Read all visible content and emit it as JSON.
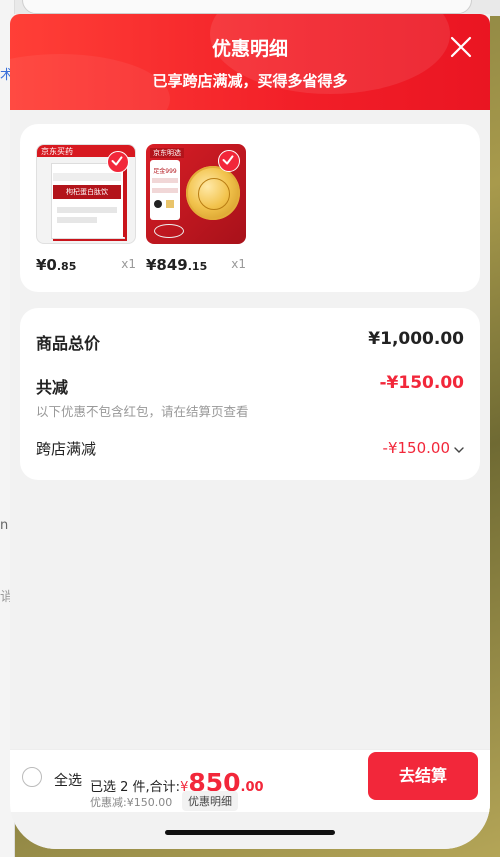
{
  "header": {
    "title": "优惠明细",
    "subtitle": "已享跨店满减，买得多省得多"
  },
  "products": [
    {
      "price_main": "¥0",
      "price_dec": ".85",
      "qty": "x1",
      "brand_tag": "京东买药",
      "product_text": "枸杞蛋白肽饮",
      "selected": true
    },
    {
      "price_main": "¥849",
      "price_dec": ".15",
      "qty": "x1",
      "brand_tag": "京东明选",
      "product_text": "足金999",
      "selected": true
    }
  ],
  "summary": {
    "total_label": "商品总价",
    "total_value": "¥1,000.00",
    "discount_label": "共减",
    "discount_value": "-¥150.00",
    "note": "以下优惠不包含红包，请在结算页查看",
    "crossstore_label": "跨店满减",
    "crossstore_value": "-¥150.00"
  },
  "footer": {
    "select_all": "全选",
    "selected_text": "已选 2 件,合计:",
    "currency": "¥",
    "amount_int": "850",
    "amount_dec": ".00",
    "discount_text": "优惠减:¥150.00",
    "detail_btn": "优惠明细",
    "checkout": "去结算"
  },
  "background": {
    "left_fragments": [
      "术",
      "n",
      "诮"
    ]
  },
  "colors": {
    "accent": "#f2273a",
    "header_start": "#ff3f37",
    "header_end": "#ea1522",
    "discount_text": "#f2273a"
  }
}
